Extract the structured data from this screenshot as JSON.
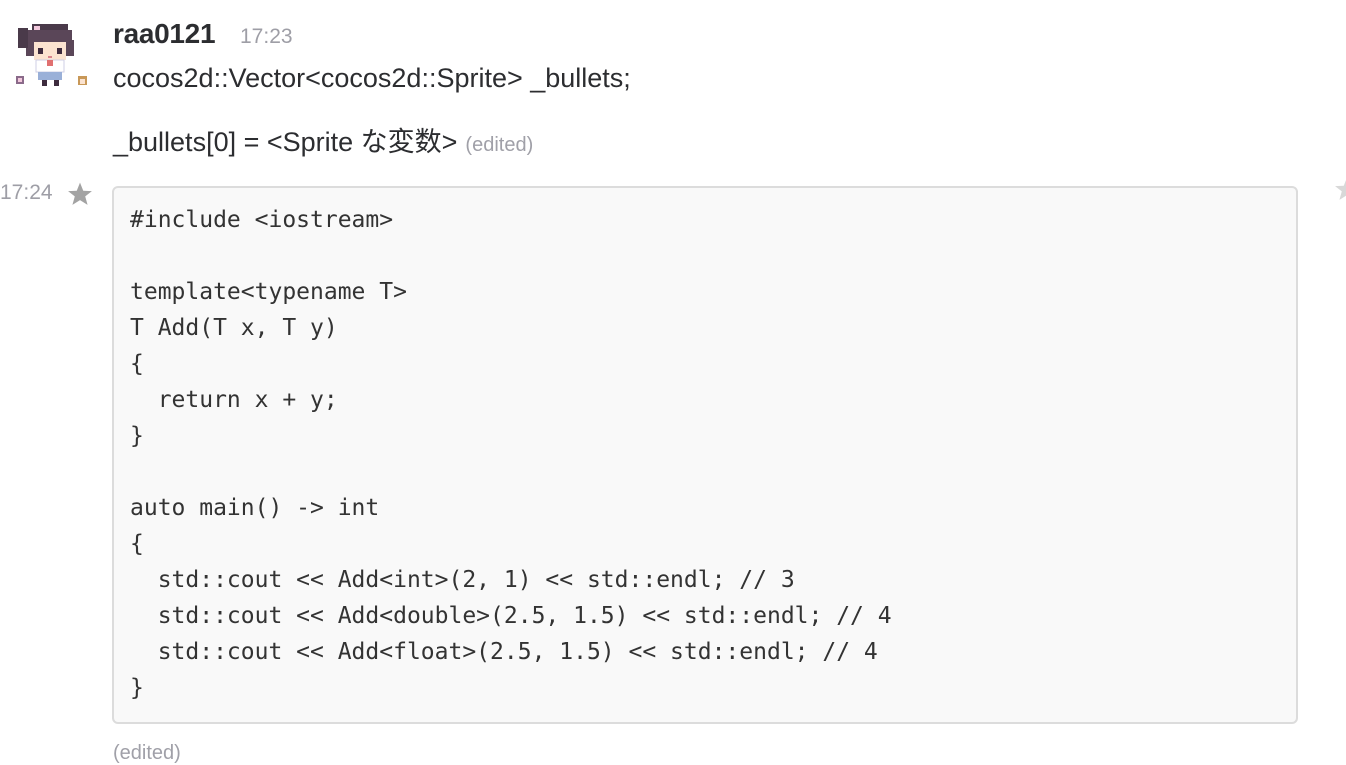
{
  "message": {
    "sender": "raa0121",
    "header_time": "17:23",
    "lines": [
      "cocos2d::Vector<cocos2d::Sprite> _bullets;",
      "_bullets[0] = <Sprite な変数>"
    ],
    "inline_edited": "(edited)"
  },
  "snippet": {
    "time": "17:24",
    "code": "#include <iostream>\n\ntemplate<typename T>\nT Add(T x, T y)\n{\n  return x + y;\n}\n\nauto main() -> int\n{\n  std::cout << Add<int>(2, 1) << std::endl; // 3\n  std::cout << Add<double>(2.5, 1.5) << std::endl; // 4\n  std::cout << Add<float>(2.5, 1.5) << std::endl; // 4\n}",
    "edited": "(edited)"
  },
  "icons": {
    "avatar": "pixel-art-avatar",
    "star": "star-icon"
  },
  "colors": {
    "text": "#2c2d30",
    "muted": "#9e9ea6",
    "code_bg": "#f9f9f9",
    "code_border": "#dcdcdc",
    "star": "#a3a3a3"
  }
}
